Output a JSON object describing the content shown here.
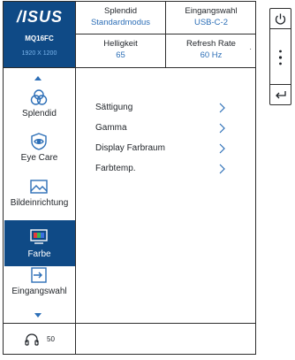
{
  "brand": {
    "logo_text": "/ISUS",
    "model": "MQ16FC",
    "resolution": "1920 X 1200"
  },
  "header": {
    "splendid": {
      "label": "Splendid",
      "value": "Standardmodus"
    },
    "input": {
      "label": "Eingangswahl",
      "value": "USB-C-2"
    },
    "brightness": {
      "label": "Helligkeit",
      "value": "65"
    },
    "refresh": {
      "label": "Refresh Rate",
      "value": "60 Hz",
      "marker": "·"
    }
  },
  "sidebar": {
    "items": [
      {
        "label": "Splendid",
        "icon": "splendid-circles-icon"
      },
      {
        "label": "Eye Care",
        "icon": "eye-shield-icon"
      },
      {
        "label": "Bildeinrichtung",
        "icon": "image-mountain-icon"
      },
      {
        "label": "Farbe",
        "icon": "color-rgb-icon",
        "active": true
      },
      {
        "label": "Eingangswahl",
        "icon": "input-arrow-icon"
      }
    ]
  },
  "menu": {
    "items": [
      {
        "label": "Sättigung"
      },
      {
        "label": "Gamma"
      },
      {
        "label": "Display Farbraum"
      },
      {
        "label": "Farbtemp."
      }
    ]
  },
  "footer": {
    "volume": "50",
    "volume_icon": "headphone-icon"
  },
  "side_keys": [
    "power-icon",
    "dots-navigate-icon",
    "return-icon"
  ],
  "colors": {
    "brand_blue": "#0f4a86",
    "accent_blue": "#2d6fb7",
    "resolution_blue": "#7bb6ee",
    "border": "#2d2d2d"
  }
}
